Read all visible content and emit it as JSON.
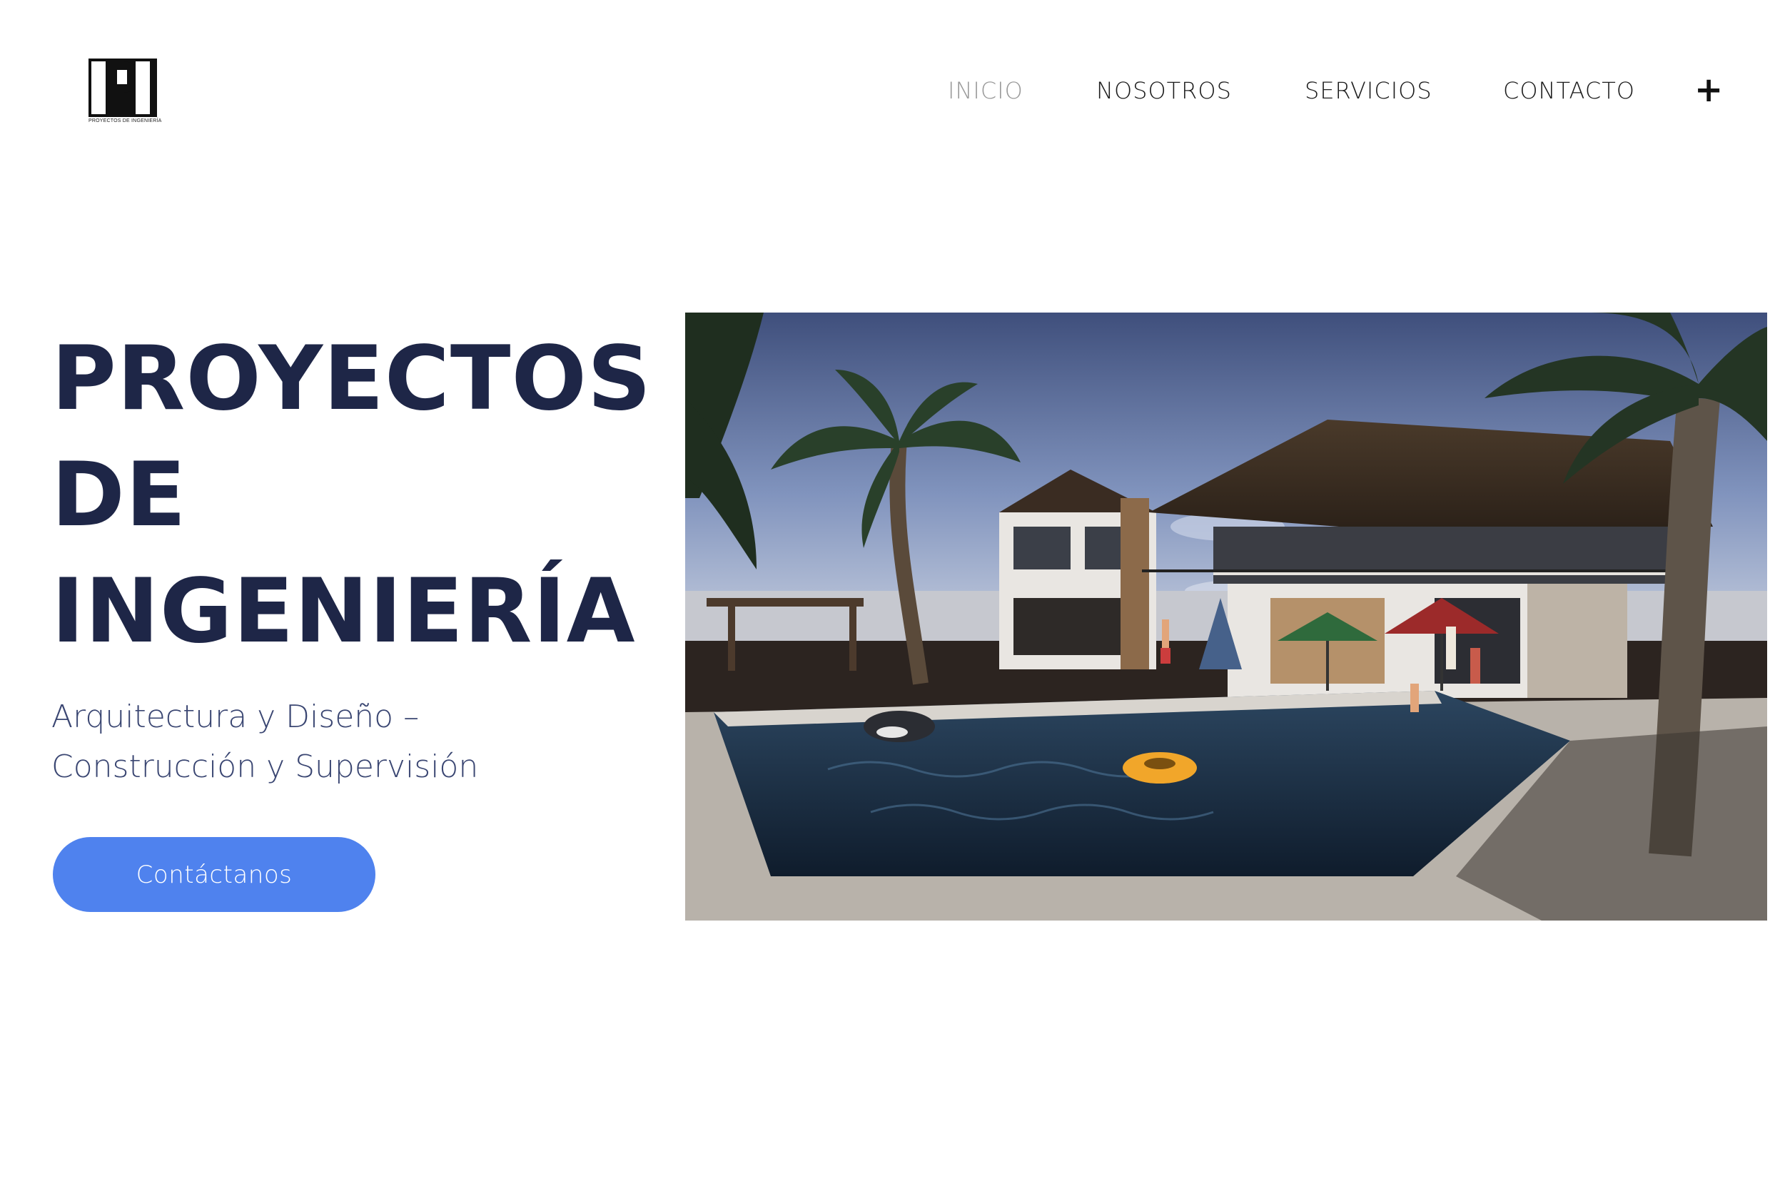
{
  "header": {
    "logo": {
      "mark": "PI",
      "subtitle": "PROYECTOS DE INGENIERÍA"
    },
    "nav": [
      {
        "label": "INICIO",
        "active": true
      },
      {
        "label": "NOSOTROS",
        "active": false
      },
      {
        "label": "SERVICIOS",
        "active": false
      },
      {
        "label": "CONTACTO",
        "active": false
      }
    ],
    "plus_icon": "plus-icon",
    "plus_label": "+"
  },
  "hero": {
    "title_lines": [
      "PROYECTOS",
      "DE",
      "INGENIERÍA"
    ],
    "subtitle_lines": [
      "Arquitectura y Diseño –",
      "Construcción y Supervisión"
    ],
    "cta_label": "Contáctanos"
  },
  "colors": {
    "title": "#1e2647",
    "subtitle": "#3a4672",
    "cta_bg": "#4f82ee",
    "nav_active": "#9a9a9a"
  }
}
